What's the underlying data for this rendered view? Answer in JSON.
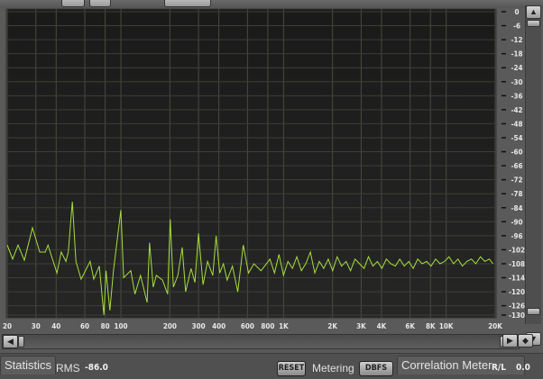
{
  "chart_data": {
    "type": "line",
    "xscale": "log",
    "xlim": [
      20,
      20000
    ],
    "ylim": [
      -130,
      0
    ],
    "grid": true,
    "x_ticks": [
      "20",
      "30",
      "40",
      "60",
      "80",
      "100",
      "200",
      "300",
      "400",
      "600",
      "800",
      "1K",
      "2K",
      "3K",
      "4K",
      "6K",
      "8K",
      "10K",
      "20K"
    ],
    "x_tick_values": [
      20,
      30,
      40,
      60,
      80,
      100,
      200,
      300,
      400,
      600,
      800,
      1000,
      2000,
      3000,
      4000,
      6000,
      8000,
      10000,
      20000
    ],
    "y_ticks": [
      "0",
      "-6",
      "-12",
      "-18",
      "-24",
      "-30",
      "-36",
      "-42",
      "-48",
      "-54",
      "-60",
      "-66",
      "-72",
      "-78",
      "-84",
      "-90",
      "-96",
      "-102",
      "-108",
      "-114",
      "-120",
      "-126",
      "-130"
    ],
    "y_tick_values": [
      0,
      -6,
      -12,
      -18,
      -24,
      -30,
      -36,
      -42,
      -48,
      -54,
      -60,
      -66,
      -72,
      -78,
      -84,
      -90,
      -96,
      -102,
      -108,
      -114,
      -120,
      -126,
      -130
    ],
    "line_color": "#a6de3c",
    "x": [
      20,
      21.6,
      23.3,
      25.5,
      28.6,
      31.7,
      34.3,
      35.6,
      40.4,
      43,
      45.9,
      47.5,
      50.3,
      52.9,
      56.9,
      64.7,
      68.1,
      73.7,
      78.6,
      81,
      85.5,
      90,
      99.9,
      104,
      115,
      122,
      132,
      145,
      150,
      158,
      165,
      180,
      194,
      201,
      210,
      224,
      238,
      250,
      270,
      285,
      300,
      320,
      341,
      367,
      385,
      405,
      427,
      450,
      485,
      523,
      565,
      609,
      657,
      727,
      825,
      879,
      937,
      999,
      1063,
      1133,
      1207,
      1287,
      1370,
      1461,
      1555,
      1658,
      1765,
      1882,
      2003,
      2136,
      2274,
      2424,
      2581,
      2751,
      2930,
      3123,
      3325,
      3545,
      3775,
      4024,
      4284,
      4567,
      4863,
      5183,
      5520,
      5884,
      6265,
      6678,
      7111,
      7580,
      8072,
      8604,
      9162,
      9766,
      10400,
      11086,
      11804,
      12583,
      13399,
      14283,
      15208,
      16212,
      17262,
      18401,
      19386
    ],
    "y": [
      -100,
      -106,
      -100,
      -106.5,
      -92.6,
      -103,
      -103,
      -100,
      -112,
      -103,
      -107,
      -103,
      -81.4,
      -107,
      -114.6,
      -107,
      -114.6,
      -109,
      -130,
      -111,
      -128,
      -111,
      -85,
      -114,
      -111,
      -121,
      -113,
      -124.6,
      -99,
      -118,
      -113,
      -115,
      -121,
      -89,
      -118,
      -113,
      -101,
      -120,
      -110,
      -116,
      -95,
      -117,
      -107,
      -113,
      -96,
      -112,
      -108,
      -115,
      -109,
      -120,
      -100,
      -112,
      -108,
      -111,
      -106,
      -112,
      -104,
      -113,
      -107,
      -110,
      -105,
      -111,
      -108,
      -103,
      -112,
      -107,
      -110,
      -106,
      -111,
      -105,
      -109,
      -107,
      -111,
      -106,
      -108,
      -110,
      -105,
      -109,
      -107,
      -110,
      -106,
      -108,
      -109,
      -106,
      -109,
      -107,
      -110,
      -106,
      -108,
      -107,
      -109,
      -106,
      -108,
      -107,
      -105,
      -108,
      -106,
      -109,
      -107,
      -106,
      -108,
      -105,
      -107,
      -106,
      -108
    ]
  },
  "statistics": {
    "tab": "Statistics",
    "rms_label": "RMS",
    "rms_value": "-86.0",
    "reset_label": "RESET",
    "metering_label": "Metering",
    "metering_value": "DBFS"
  },
  "correlation": {
    "tab": "Correlation Meter",
    "rl_label": "R/L",
    "rl_value": "0.0"
  },
  "icons": {
    "scroll_up": "triangle-up",
    "scroll_down": "triangle-down",
    "scroll_left": "triangle-left",
    "scroll_right": "triangle-right",
    "zoom": "diamond"
  }
}
